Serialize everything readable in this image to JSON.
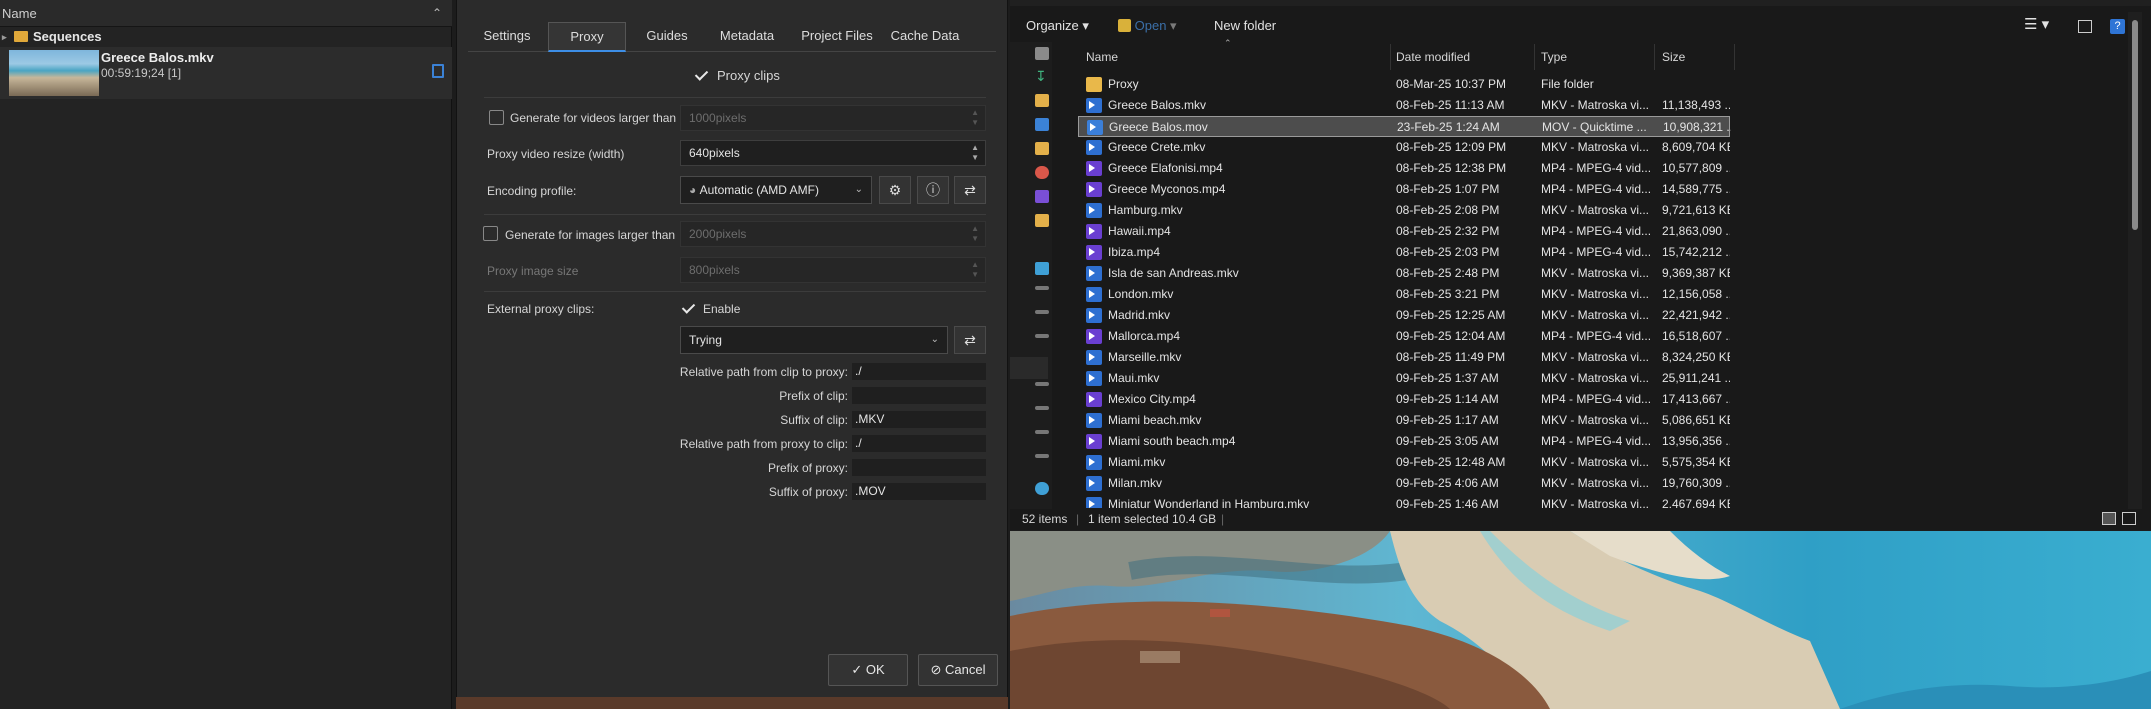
{
  "bin": {
    "header": "Name",
    "sequences_label": "Sequences",
    "clip": {
      "name": "Greece Balos.mkv",
      "meta": "00:59:19;24 [1]"
    }
  },
  "dialog": {
    "tabs": [
      "Settings",
      "Proxy",
      "Guides",
      "Metadata",
      "Project Files",
      "Cache Data"
    ],
    "active_tab": "Proxy",
    "proxy_clips_label": "Proxy clips",
    "gen_videos_label": "Generate for videos larger than",
    "gen_videos_value": "1000pixels",
    "resize_label": "Proxy video resize (width)",
    "resize_value": "640pixels",
    "encoding_label": "Encoding profile:",
    "encoding_value": "Automatic (AMD AMF)",
    "gen_images_label": "Generate for images larger than",
    "gen_images_value": "2000pixels",
    "image_size_label": "Proxy image size",
    "image_size_value": "800pixels",
    "external_label": "External proxy clips:",
    "enable_label": "Enable",
    "profile_value": "Trying",
    "paths": [
      {
        "label": "Relative path from clip to proxy:",
        "value": "./"
      },
      {
        "label": "Prefix of clip:",
        "value": ""
      },
      {
        "label": "Suffix of clip:",
        "value": ".MKV"
      },
      {
        "label": "Relative path from proxy to clip:",
        "value": "./"
      },
      {
        "label": "Prefix of proxy:",
        "value": ""
      },
      {
        "label": "Suffix of proxy:",
        "value": ".MOV"
      }
    ],
    "ok_label": "OK",
    "cancel_label": "Cancel"
  },
  "explorer": {
    "toolbar": {
      "organize": "Organize",
      "open": "Open",
      "new_folder": "New folder"
    },
    "columns": [
      "Name",
      "Date modified",
      "Type",
      "Size"
    ],
    "files": [
      {
        "name": "Proxy",
        "date": "08-Mar-25 10:37 PM",
        "type": "File folder",
        "size": "",
        "kind": "folder"
      },
      {
        "name": "Greece Balos.mkv",
        "date": "08-Feb-25 11:13 AM",
        "type": "MKV - Matroska vi...",
        "size": "11,138,493 ...",
        "kind": "mkv"
      },
      {
        "name": "Greece Balos.mov",
        "date": "23-Feb-25 1:24 AM",
        "type": "MOV - Quicktime ...",
        "size": "10,908,321 ...",
        "kind": "mov",
        "selected": true
      },
      {
        "name": "Greece Crete.mkv",
        "date": "08-Feb-25 12:09 PM",
        "type": "MKV - Matroska vi...",
        "size": "8,609,704 KB",
        "kind": "mkv"
      },
      {
        "name": "Greece Elafonisi.mp4",
        "date": "08-Feb-25 12:38 PM",
        "type": "MP4 - MPEG-4 vid...",
        "size": "10,577,809 ...",
        "kind": "mp4"
      },
      {
        "name": "Greece Myconos.mp4",
        "date": "08-Feb-25 1:07 PM",
        "type": "MP4 - MPEG-4 vid...",
        "size": "14,589,775 ...",
        "kind": "mp4"
      },
      {
        "name": "Hamburg.mkv",
        "date": "08-Feb-25 2:08 PM",
        "type": "MKV - Matroska vi...",
        "size": "9,721,613 KB",
        "kind": "mkv"
      },
      {
        "name": "Hawaii.mp4",
        "date": "08-Feb-25 2:32 PM",
        "type": "MP4 - MPEG-4 vid...",
        "size": "21,863,090 ...",
        "kind": "mp4"
      },
      {
        "name": "Ibiza.mp4",
        "date": "08-Feb-25 2:03 PM",
        "type": "MP4 - MPEG-4 vid...",
        "size": "15,742,212 ...",
        "kind": "mp4"
      },
      {
        "name": "Isla de san Andreas.mkv",
        "date": "08-Feb-25 2:48 PM",
        "type": "MKV - Matroska vi...",
        "size": "9,369,387 KB",
        "kind": "mkv"
      },
      {
        "name": "London.mkv",
        "date": "08-Feb-25 3:21 PM",
        "type": "MKV - Matroska vi...",
        "size": "12,156,058 ...",
        "kind": "mkv"
      },
      {
        "name": "Madrid.mkv",
        "date": "09-Feb-25 12:25 AM",
        "type": "MKV - Matroska vi...",
        "size": "22,421,942 ...",
        "kind": "mkv"
      },
      {
        "name": "Mallorca.mp4",
        "date": "09-Feb-25 12:04 AM",
        "type": "MP4 - MPEG-4 vid...",
        "size": "16,518,607 ...",
        "kind": "mp4"
      },
      {
        "name": "Marseille.mkv",
        "date": "08-Feb-25 11:49 PM",
        "type": "MKV - Matroska vi...",
        "size": "8,324,250 KB",
        "kind": "mkv"
      },
      {
        "name": "Maui.mkv",
        "date": "09-Feb-25 1:37 AM",
        "type": "MKV - Matroska vi...",
        "size": "25,911,241 ...",
        "kind": "mkv"
      },
      {
        "name": "Mexico City.mp4",
        "date": "09-Feb-25 1:14 AM",
        "type": "MP4 - MPEG-4 vid...",
        "size": "17,413,667 ...",
        "kind": "mp4"
      },
      {
        "name": "Miami beach.mkv",
        "date": "09-Feb-25 1:17 AM",
        "type": "MKV - Matroska vi...",
        "size": "5,086,651 KB",
        "kind": "mkv"
      },
      {
        "name": "Miami south beach.mp4",
        "date": "09-Feb-25 3:05 AM",
        "type": "MP4 - MPEG-4 vid...",
        "size": "13,956,356 ...",
        "kind": "mp4"
      },
      {
        "name": "Miami.mkv",
        "date": "09-Feb-25 12:48 AM",
        "type": "MKV - Matroska vi...",
        "size": "5,575,354 KB",
        "kind": "mkv"
      },
      {
        "name": "Milan.mkv",
        "date": "09-Feb-25 4:06 AM",
        "type": "MKV - Matroska vi...",
        "size": "19,760,309 ...",
        "kind": "mkv"
      },
      {
        "name": "Miniatur Wonderland in Hamburg.mkv",
        "date": "09-Feb-25 1:46 AM",
        "type": "MKV - Matroska vi...",
        "size": "2,467,694 KB",
        "kind": "mkv"
      }
    ],
    "status": {
      "count": "52 items",
      "selection": "1 item selected  10.4 GB"
    }
  }
}
